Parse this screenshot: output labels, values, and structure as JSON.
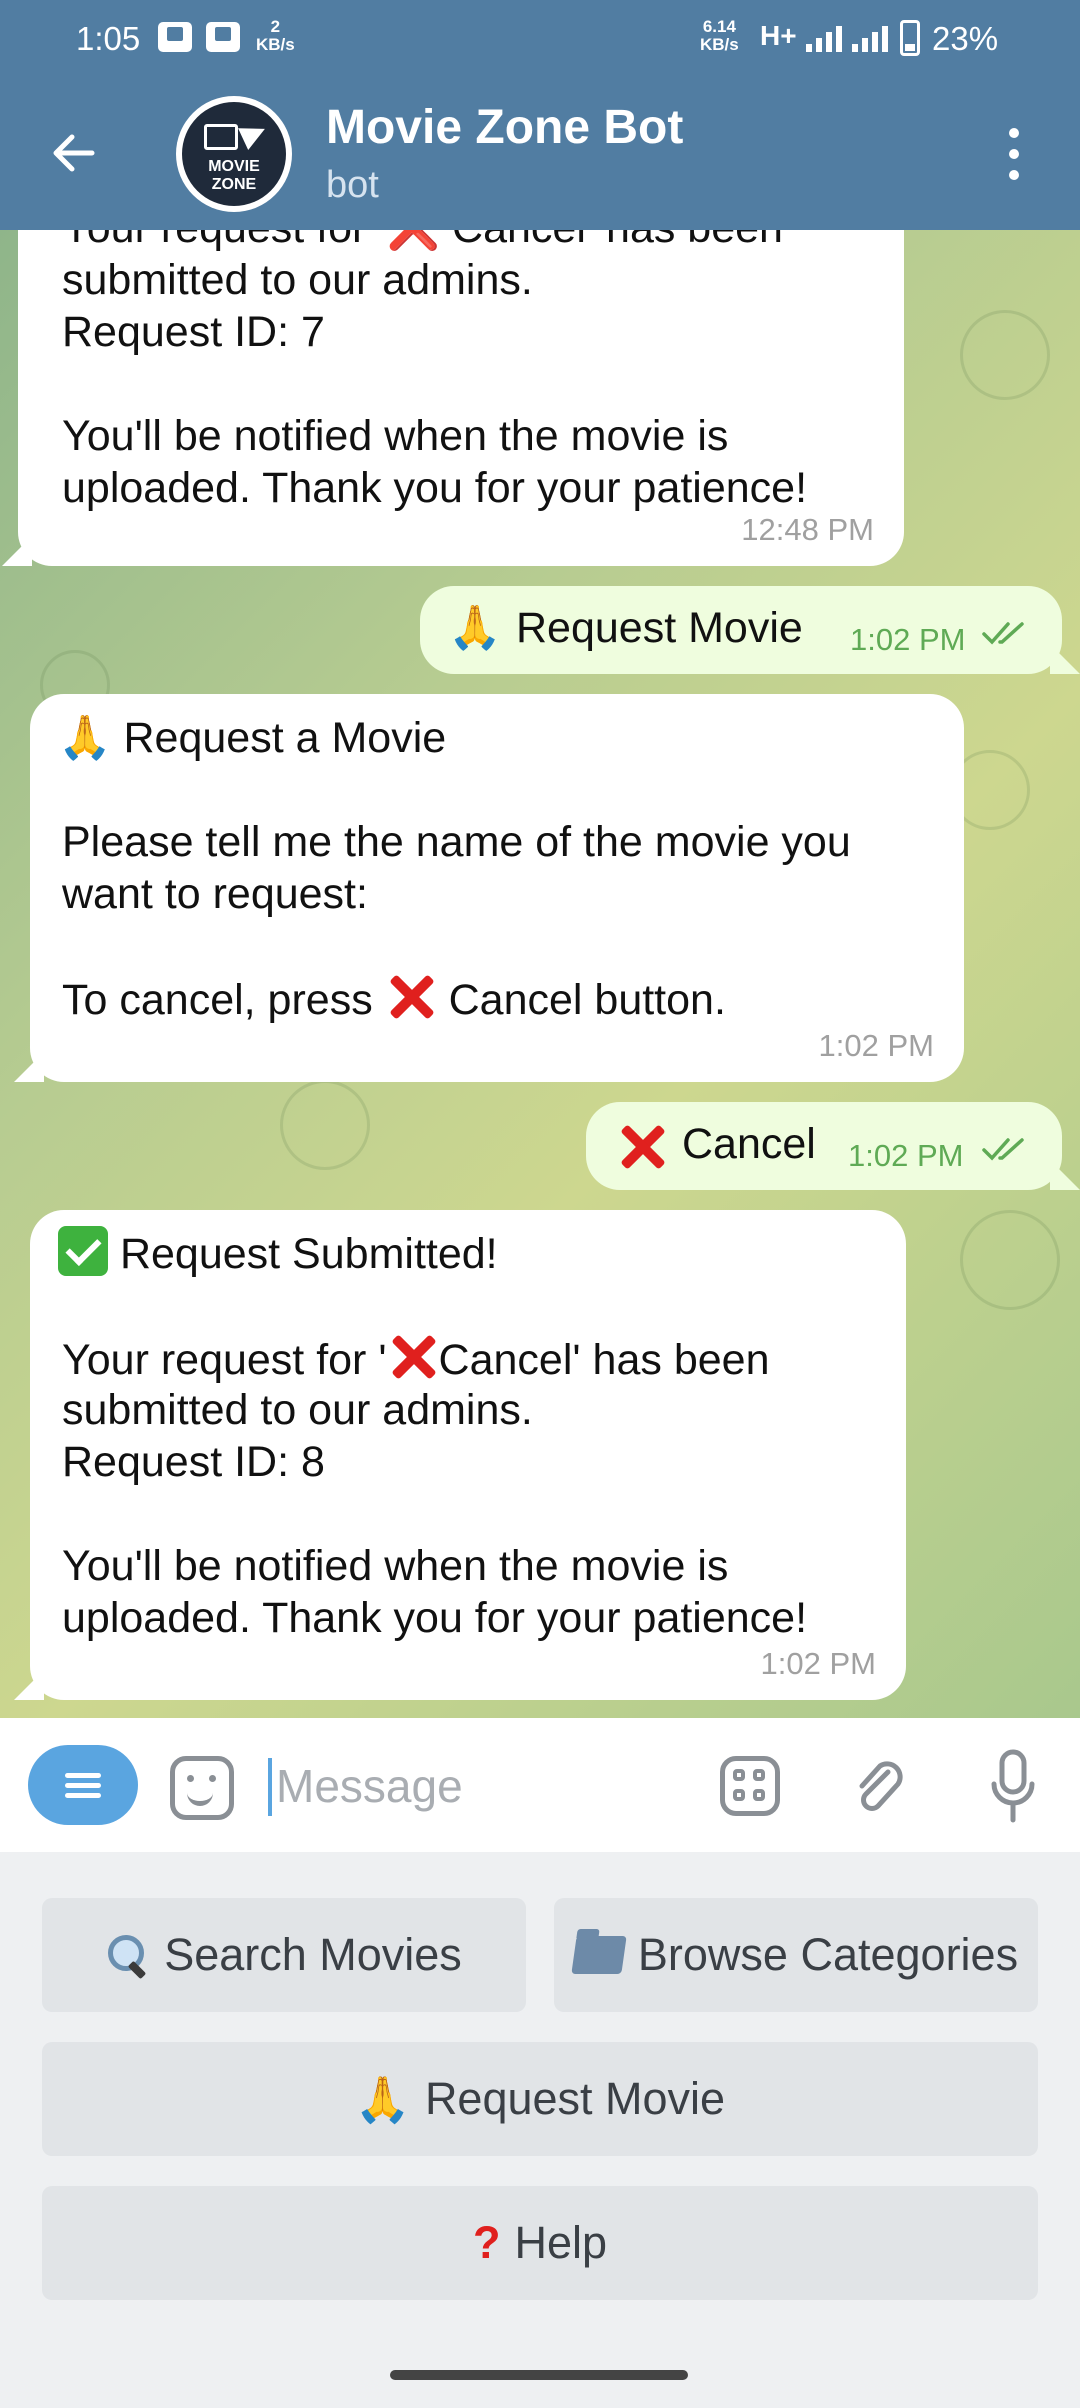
{
  "status_bar": {
    "time": "1:05",
    "kbs_left_value": "2",
    "kbs_left_unit": "KB/s",
    "kbs_right_value": "6.14",
    "kbs_right_unit": "KB/s",
    "network": "H+",
    "battery": "23%"
  },
  "header": {
    "title": "Movie Zone Bot",
    "subtitle": "bot",
    "avatar_line1": "MOVIE",
    "avatar_line2": "ZONE"
  },
  "messages": [
    {
      "direction": "in",
      "text": "Your request for '❌ Cancel' has been\nsubmitted to our admins.\nRequest ID: 7\n\nYou'll be notified when the movie is\nuploaded. Thank you for your patience!",
      "time": "12:48 PM"
    },
    {
      "direction": "out",
      "text": "Request Movie",
      "emoji": "🙏",
      "time": "1:02 PM",
      "read": true
    },
    {
      "direction": "in",
      "heading": "Request a Movie",
      "line1": "Please tell me the name of the movie you",
      "line2": "want to request:",
      "line3a": "To cancel, press",
      "line3b": "Cancel button.",
      "time": "1:02 PM"
    },
    {
      "direction": "out",
      "text": "Cancel",
      "time": "1:02 PM",
      "read": true
    },
    {
      "direction": "in",
      "heading": "Request Submitted!",
      "line1a": "Your request for '",
      "line1b": "Cancel' has been",
      "line2": "submitted to our admins.",
      "line3": "Request ID: 8",
      "line4": "You'll be notified when the movie is",
      "line5": "uploaded. Thank you for your patience!",
      "time": "1:02 PM"
    }
  ],
  "input": {
    "placeholder": "Message"
  },
  "keyboard": {
    "search": "Search Movies",
    "browse": "Browse Categories",
    "request": "Request Movie",
    "help": "Help"
  },
  "colors": {
    "header": "#517da2",
    "accent": "#5aa5e0",
    "outgoing": "#effdde",
    "cancel_red": "#e0201e"
  },
  "icons": [
    "back-arrow-icon",
    "more-vert-icon",
    "bot-menu-icon",
    "sticker-icon",
    "bot-commands-icon",
    "attach-icon",
    "mic-icon",
    "search-icon",
    "folder-icon",
    "pray-emoji-icon",
    "cross-mark-icon",
    "check-mark-icon",
    "question-mark-icon"
  ]
}
